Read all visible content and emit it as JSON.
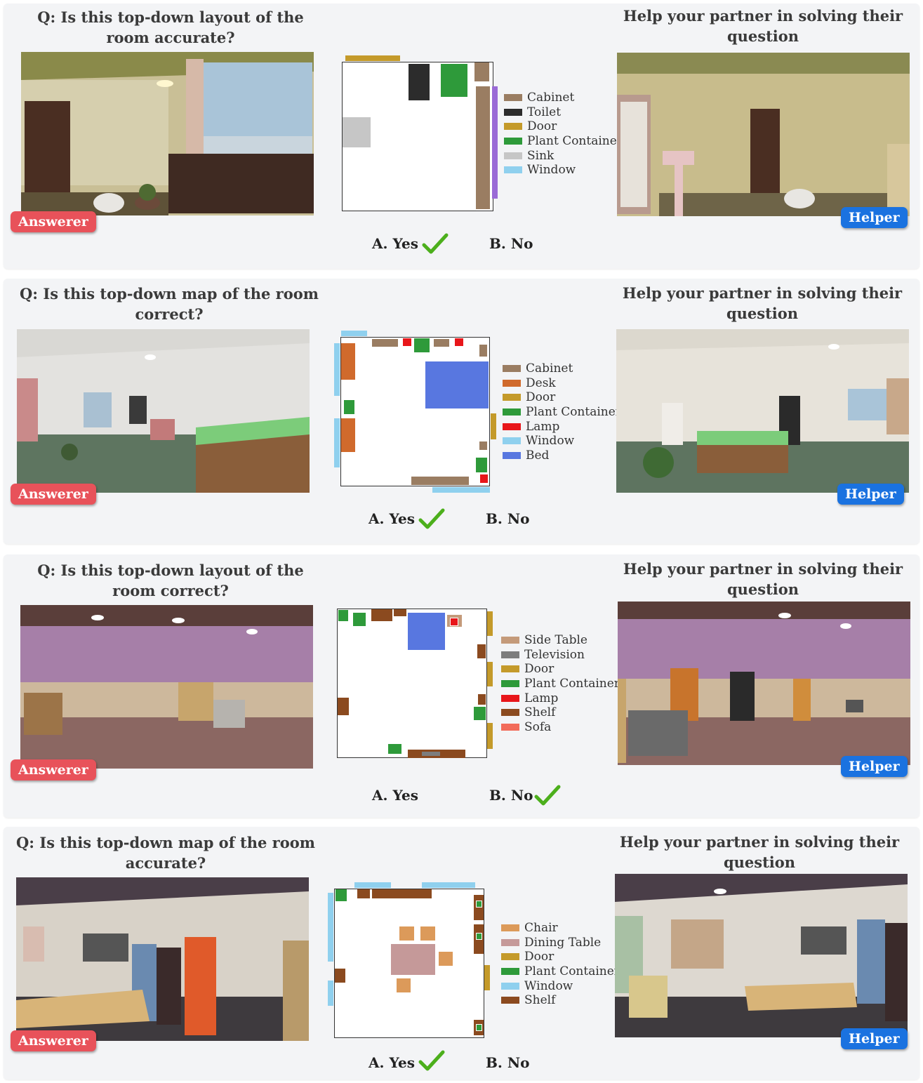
{
  "colors": {
    "cabinet": "#9a7d62",
    "toilet": "#2c2c2c",
    "door": "#c49a2a",
    "plant": "#2e9a3a",
    "sink": "#c6c6c6",
    "window": "#8fd0ee",
    "desk": "#d06a2c",
    "lamp": "#e8161a",
    "bed": "#5877e0",
    "side_table": "#c49a7a",
    "television": "#7d7d7d",
    "shelf": "#8b4a1f",
    "sofa": "#f26b5a",
    "chair": "#dc9a5a",
    "dining_table": "#c59999",
    "check": "#4caf1c",
    "answerer_tag": "#e8525a",
    "helper_tag": "#1a72e0"
  },
  "roles": {
    "answerer": "Answerer",
    "helper": "Helper"
  },
  "options": {
    "yes": "A. Yes",
    "no": "B. No"
  },
  "panels": [
    {
      "question": "Q: Is this top-down layout of the room accurate?",
      "helper_prompt": "Help your partner in solving their question",
      "legend": [
        {
          "label": "Cabinet",
          "color_key": "cabinet"
        },
        {
          "label": "Toilet",
          "color_key": "toilet"
        },
        {
          "label": "Door",
          "color_key": "door"
        },
        {
          "label": "Plant Container",
          "color_key": "plant"
        },
        {
          "label": "Sink",
          "color_key": "sink"
        },
        {
          "label": "Window",
          "color_key": "window"
        }
      ],
      "correct_answer": "A. Yes"
    },
    {
      "question": "Q: Is this top-down map of the room correct?",
      "helper_prompt": "Help your partner in solving their question",
      "legend": [
        {
          "label": "Cabinet",
          "color_key": "cabinet"
        },
        {
          "label": "Desk",
          "color_key": "desk"
        },
        {
          "label": "Door",
          "color_key": "door"
        },
        {
          "label": "Plant Container",
          "color_key": "plant"
        },
        {
          "label": "Lamp",
          "color_key": "lamp"
        },
        {
          "label": "Window",
          "color_key": "window"
        },
        {
          "label": "Bed",
          "color_key": "bed"
        }
      ],
      "correct_answer": "A. Yes"
    },
    {
      "question": "Q: Is this top-down layout of the room correct?",
      "helper_prompt": "Help your partner in solving their question",
      "legend": [
        {
          "label": "Side Table",
          "color_key": "side_table"
        },
        {
          "label": "Television",
          "color_key": "television"
        },
        {
          "label": "Door",
          "color_key": "door"
        },
        {
          "label": "Plant Container",
          "color_key": "plant"
        },
        {
          "label": "Lamp",
          "color_key": "lamp"
        },
        {
          "label": "Shelf",
          "color_key": "shelf"
        },
        {
          "label": "Sofa",
          "color_key": "sofa"
        }
      ],
      "correct_answer": "B. No"
    },
    {
      "question": "Q: Is this top-down map of the room accurate?",
      "helper_prompt": "Help your partner in solving their question",
      "legend": [
        {
          "label": "Chair",
          "color_key": "chair"
        },
        {
          "label": "Dining Table",
          "color_key": "dining_table"
        },
        {
          "label": "Door",
          "color_key": "door"
        },
        {
          "label": "Plant Container",
          "color_key": "plant"
        },
        {
          "label": "Window",
          "color_key": "window"
        },
        {
          "label": "Shelf",
          "color_key": "shelf"
        }
      ],
      "correct_answer": "A. Yes"
    }
  ]
}
